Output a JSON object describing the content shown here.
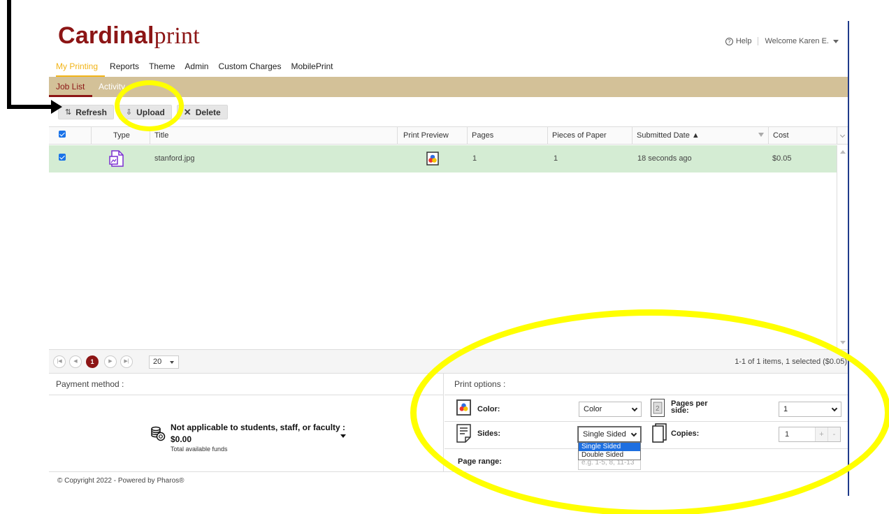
{
  "brand": {
    "bold": "Cardinal",
    "light": "print"
  },
  "header": {
    "help_label": "Help",
    "welcome_label": "Welcome Karen E."
  },
  "nav": {
    "items": [
      "My Printing",
      "Reports",
      "Theme",
      "Admin",
      "Custom Charges",
      "MobilePrint"
    ],
    "active": "My Printing"
  },
  "subnav": {
    "items": [
      "Job List",
      "Activity"
    ],
    "active": "Job List"
  },
  "toolbar": {
    "refresh_label": "Refresh",
    "upload_label": "Upload",
    "delete_label": "Delete"
  },
  "grid": {
    "columns": [
      "Type",
      "Title",
      "Print Preview",
      "Pages",
      "Pieces of Paper",
      "Submitted Date ▲",
      "Cost"
    ],
    "rows": [
      {
        "selected": true,
        "type_icon": "image-file-icon",
        "title": "stanford.jpg",
        "preview_icon": "color-preview-icon",
        "pages": "1",
        "pieces": "1",
        "submitted": "18 seconds ago",
        "cost": "$0.05"
      }
    ]
  },
  "pager": {
    "current_page": "1",
    "page_size": "20",
    "info": "1-1 of 1 items, 1 selected ($0.05)"
  },
  "payment": {
    "title": "Payment method :",
    "method_title": "Not applicable to students, staff, or faculty :",
    "amount": "$0.00",
    "subtitle": "Total available funds"
  },
  "options": {
    "title": "Print options :",
    "color_label": "Color:",
    "color_value": "Color",
    "pps_label": "Pages per side:",
    "pps_value": "1",
    "sides_label": "Sides:",
    "sides_value": "Single Sided",
    "sides_options": [
      "Single Sided",
      "Double Sided"
    ],
    "copies_label": "Copies:",
    "copies_value": "1",
    "page_range_label": "Page range:",
    "page_range_placeholder": "e.g. 1-5, 8, 11-13"
  },
  "footer": {
    "copyright": "© Copyright 2022 - Powered by Pharos®"
  },
  "colors": {
    "brand": "#8c1515",
    "accent": "#f2b418",
    "subnav_bg": "#d3c198",
    "row_selected": "#d4ecd3",
    "annotation": "#ffff00"
  }
}
